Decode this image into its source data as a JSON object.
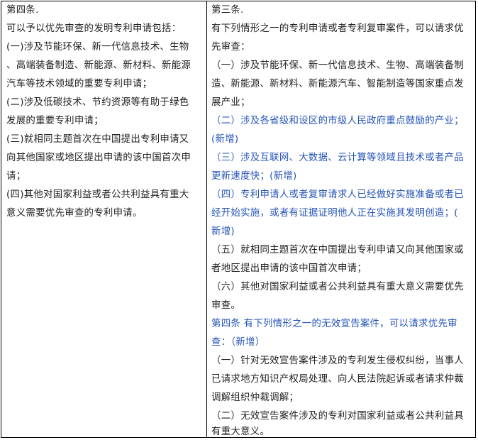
{
  "colors": {
    "text": "#222222",
    "highlight_blue": "#2554b8",
    "border": "#000000"
  },
  "left": {
    "lines": [
      "第四条.",
      "可以予以优先审查的发明专利申请包括：",
      "(一)涉及节能环保、新一代信息技术、生物",
      "、高端装备制造、新能源、新材料、新能源",
      "汽车等技术领域的重要专利申请；",
      "(二)涉及低碳技术、节约资源等有助于绿色",
      "发展的重要专利申请；",
      "(三)就相同主题首次在中国提出专利申请又",
      "向其他国家或地区提出申请的该中国首次申",
      "请；",
      "(四)其他对国家利益或者公共利益具有重大",
      "意义需要优先审查的专利申请。"
    ]
  },
  "right": {
    "lines": [
      {
        "text": "第三条.",
        "blue": false
      },
      {
        "text": "有下列情形之一的专利申请或者专利复审案件，可以请求优",
        "blue": false
      },
      {
        "text": "先审查：",
        "blue": false
      },
      {
        "text": "（一）涉及节能环保、新一代信息技术、生物、高端装备制",
        "blue": false
      },
      {
        "text": "造、新能源、新材料、新能源汽车、智能制造等国家重点发",
        "blue": false
      },
      {
        "text": "展产业；",
        "blue": false
      },
      {
        "text": "（二）涉及各省级和设区的市级人民政府重点鼓励的产业；",
        "blue": true
      },
      {
        "text": "(新增)",
        "blue": true
      },
      {
        "text": "（三）涉及互联网、大数据、云计算等领域且技术或者产品",
        "blue": true
      },
      {
        "text": "更新速度快；(新增)",
        "blue": true
      },
      {
        "text": "（四）专利申请人或者复审请求人已经做好实施准备或者已",
        "blue": true
      },
      {
        "text": "经开始实施，或者有证据证明他人正在实施其发明创造；(",
        "blue": true
      },
      {
        "text": "新增)",
        "blue": true
      },
      {
        "text": "（五）就相同主题首次在中国提出专利申请又向其他国家或",
        "blue": false
      },
      {
        "text": "者地区提出申请的该中国首次申请；",
        "blue": false
      },
      {
        "text": "（六）其他对国家利益或者公共利益具有重大意义需要优先",
        "blue": false
      },
      {
        "text": "审查。",
        "blue": false
      },
      {
        "text": "第四条 有下列情形之一的无效宣告案件，可以请求优先审",
        "blue": true
      },
      {
        "text": "查：（新增）",
        "blue": true
      },
      {
        "text": "（一）针对无效宣告案件涉及的专利发生侵权纠纷，当事人",
        "blue": false
      },
      {
        "text": "已请求地方知识产权局处理、向人民法院起诉或者请求仲裁",
        "blue": false
      },
      {
        "text": "调解组织仲裁调解；",
        "blue": false
      },
      {
        "text": "（二）无效宣告案件涉及的专利对国家利益或者公共利益具",
        "blue": false
      },
      {
        "text": "有重大意义。",
        "blue": false
      }
    ]
  }
}
